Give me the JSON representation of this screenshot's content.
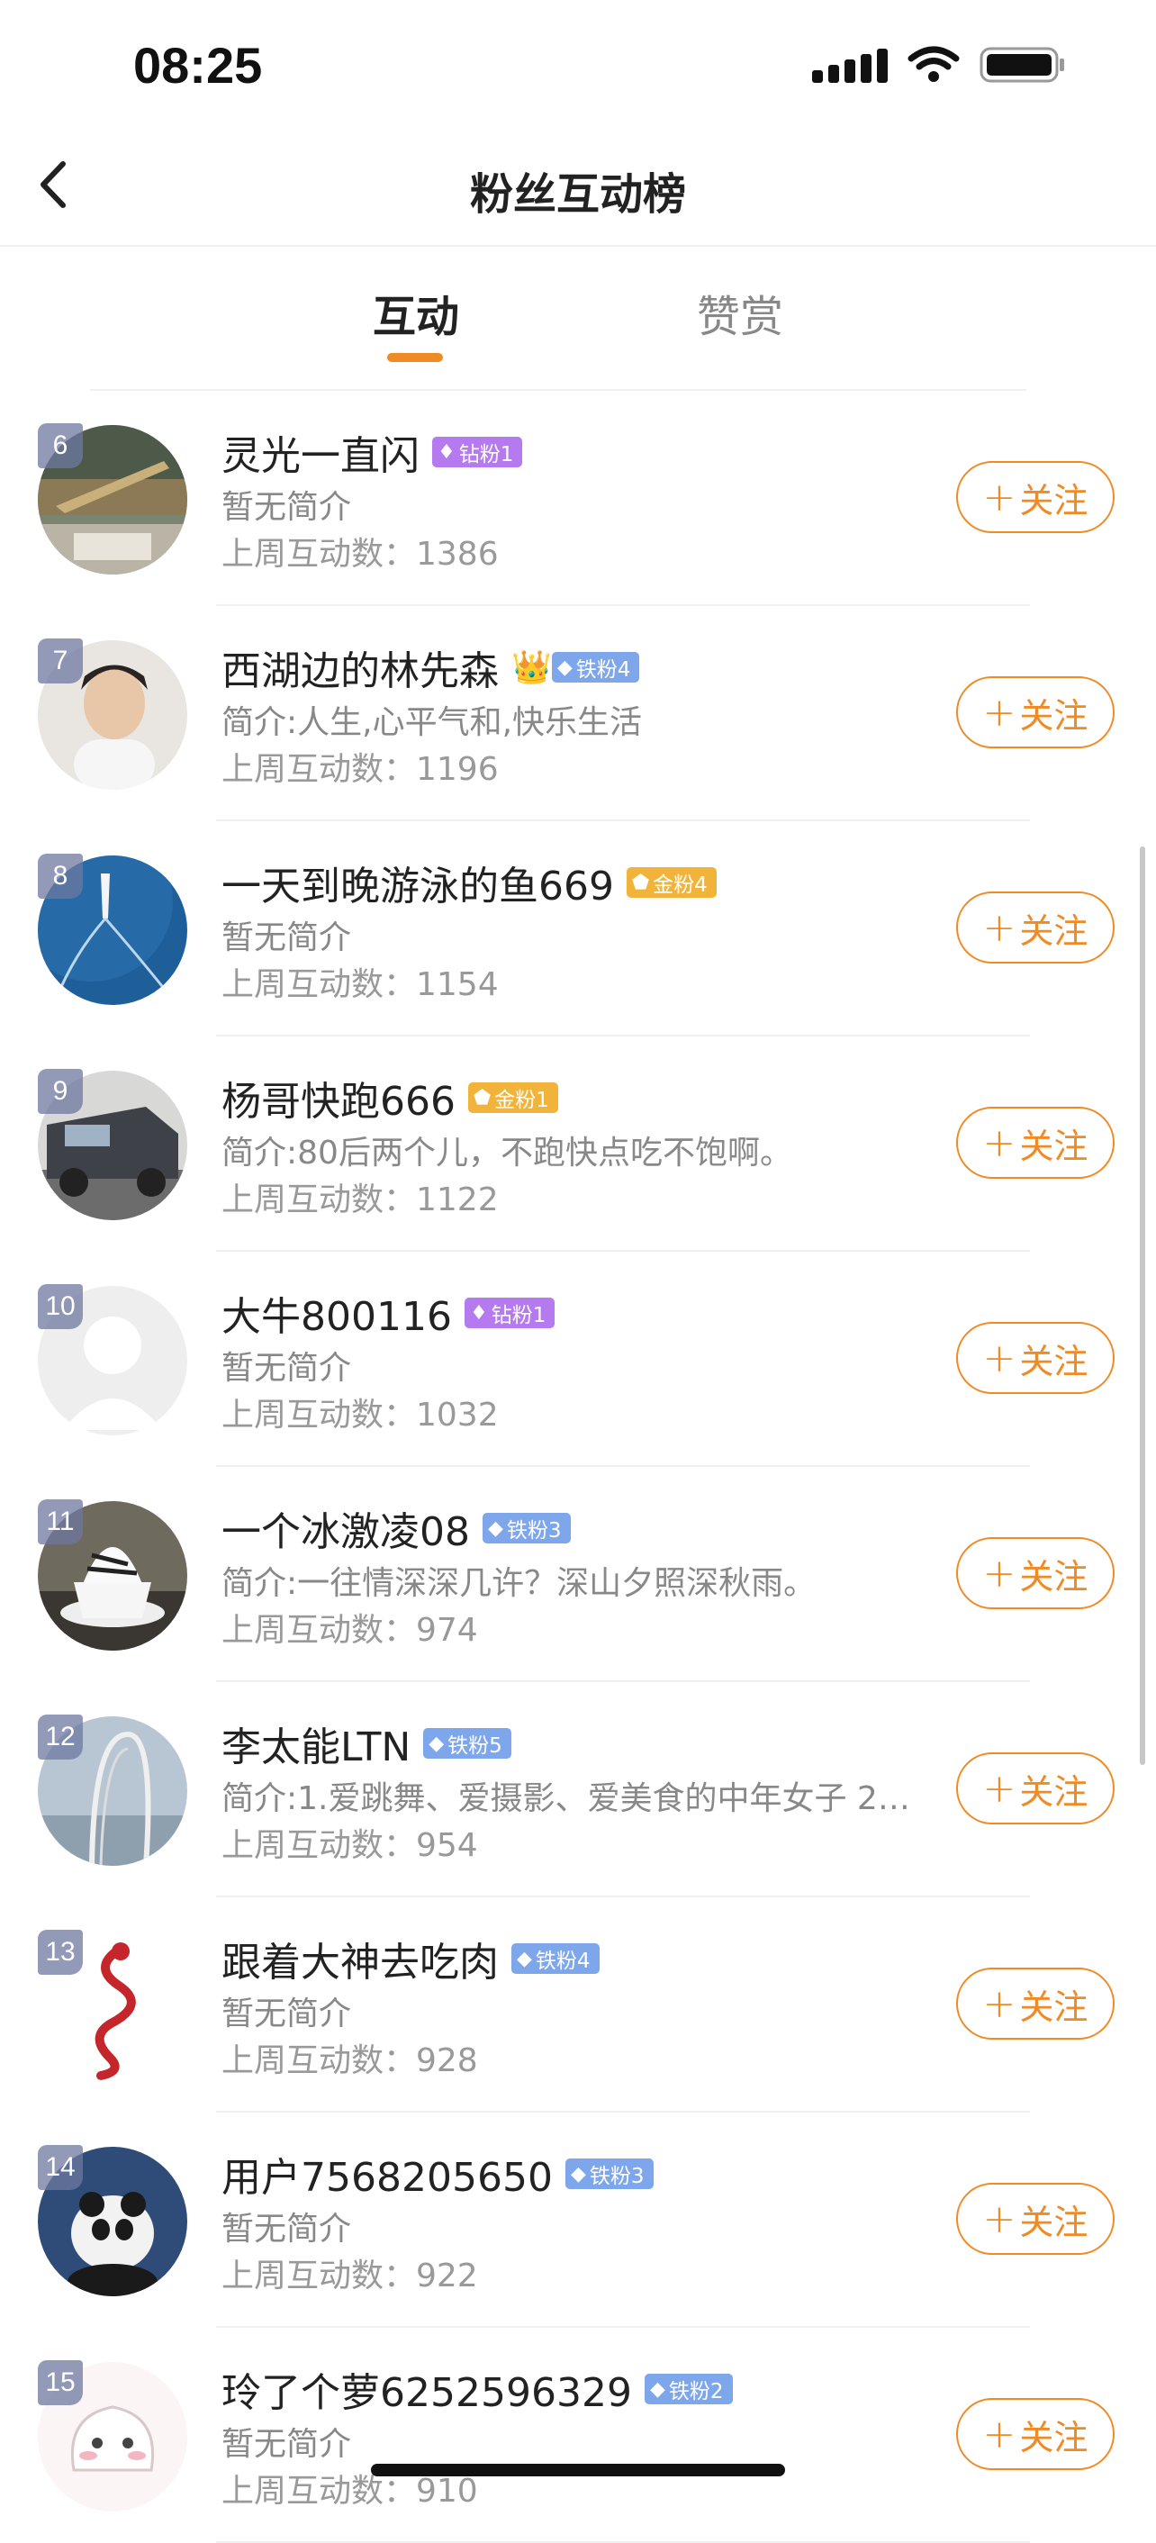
{
  "status_bar": {
    "time": "08:25"
  },
  "nav": {
    "title": "粉丝互动榜"
  },
  "tabs": [
    {
      "label": "互动"
    },
    {
      "label": "赞赏"
    }
  ],
  "follow_label": "关注",
  "colors": {
    "accent": "#f08a25",
    "diamond": "#b57af0",
    "gold": "#f2b33a",
    "iron": "#7ea6ea"
  },
  "rows": [
    {
      "rank": "6",
      "name": "灵光一直闪",
      "badge": "钻粉1",
      "badge_type": "diamond",
      "desc": "暂无简介",
      "count": "上周互动数：1386"
    },
    {
      "rank": "7",
      "name": "西湖边的林先森",
      "badge": "铁粉4",
      "badge_type": "iron",
      "crown": true,
      "desc": "简介:人生,心平气和,快乐生活",
      "count": "上周互动数：1196"
    },
    {
      "rank": "8",
      "name": "一天到晚游泳的鱼669",
      "badge": "金粉4",
      "badge_type": "gold",
      "desc": "暂无简介",
      "count": "上周互动数：1154"
    },
    {
      "rank": "9",
      "name": "杨哥快跑666",
      "badge": "金粉1",
      "badge_type": "gold",
      "desc": "简介:80后两个儿，不跑快点吃不饱啊。",
      "count": "上周互动数：1122"
    },
    {
      "rank": "10",
      "name": "大牛800116",
      "badge": "钻粉1",
      "badge_type": "diamond",
      "desc": "暂无简介",
      "count": "上周互动数：1032"
    },
    {
      "rank": "11",
      "name": "一个冰激凌08",
      "badge": "铁粉3",
      "badge_type": "iron",
      "desc": "简介:一往情深深几许？深山夕照深秋雨。",
      "count": "上周互动数：974"
    },
    {
      "rank": "12",
      "name": "李太能LTN",
      "badge": "铁粉5",
      "badge_type": "iron",
      "desc": "简介:1.爱跳舞、爱摄影、爱美食的中年女子 2....",
      "count": "上周互动数：954"
    },
    {
      "rank": "13",
      "name": "跟着大神去吃肉",
      "badge": "铁粉4",
      "badge_type": "iron",
      "desc": "暂无简介",
      "count": "上周互动数：928"
    },
    {
      "rank": "14",
      "name": "用户7568205650",
      "badge": "铁粉3",
      "badge_type": "iron",
      "desc": "暂无简介",
      "count": "上周互动数：922"
    },
    {
      "rank": "15",
      "name": "玲了个萝6252596329",
      "badge": "铁粉2",
      "badge_type": "iron",
      "desc": "暂无简介",
      "count": "上周互动数：910"
    }
  ]
}
